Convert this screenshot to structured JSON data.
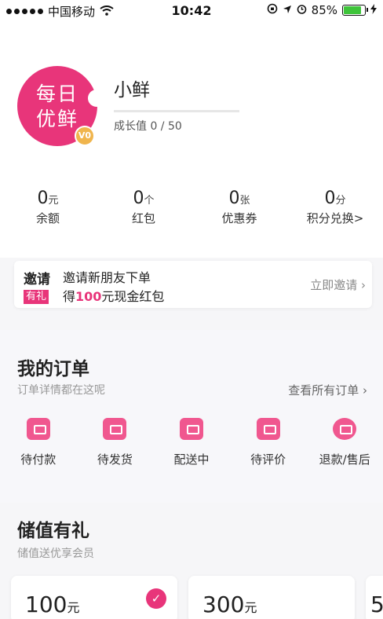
{
  "status_bar": {
    "carrier": "中国移动",
    "time": "10:42",
    "battery": "85%"
  },
  "profile": {
    "logo_line1": "每日",
    "logo_line2": "优鲜",
    "vip_badge": "V0",
    "username": "小鲜",
    "growth": "成长值 0 / 50"
  },
  "stats": [
    {
      "num": "0",
      "unit": "元",
      "label": "余额"
    },
    {
      "num": "0",
      "unit": "个",
      "label": "红包"
    },
    {
      "num": "0",
      "unit": "张",
      "label": "优惠券"
    },
    {
      "num": "0",
      "unit": "分",
      "label": "积分兑换>"
    }
  ],
  "invite": {
    "title": "邀请",
    "tag": "有礼",
    "line1": "邀请新朋友下单",
    "line2_prefix": "得",
    "line2_amount": "100",
    "line2_suffix": "元现金红包",
    "action": "立即邀请 ›"
  },
  "orders": {
    "title": "我的订单",
    "subtitle": "订单详情都在这呢",
    "view_all": "查看所有订单 ›",
    "items": [
      {
        "label": "待付款",
        "icon": "wallet-icon"
      },
      {
        "label": "待发货",
        "icon": "package-icon"
      },
      {
        "label": "配送中",
        "icon": "delivery-truck-icon"
      },
      {
        "label": "待评价",
        "icon": "comment-icon"
      },
      {
        "label": "退款/售后",
        "icon": "refund-icon"
      }
    ]
  },
  "stored_value": {
    "title": "储值有礼",
    "subtitle": "储值送优享会员",
    "cards": [
      {
        "amount": "100",
        "unit": "元",
        "selected": true
      },
      {
        "amount": "300",
        "unit": "元",
        "selected": false
      },
      {
        "amount": "5",
        "unit": "",
        "selected": false
      }
    ]
  },
  "colors": {
    "accent": "#e8357a",
    "battery": "#3ec43a"
  }
}
